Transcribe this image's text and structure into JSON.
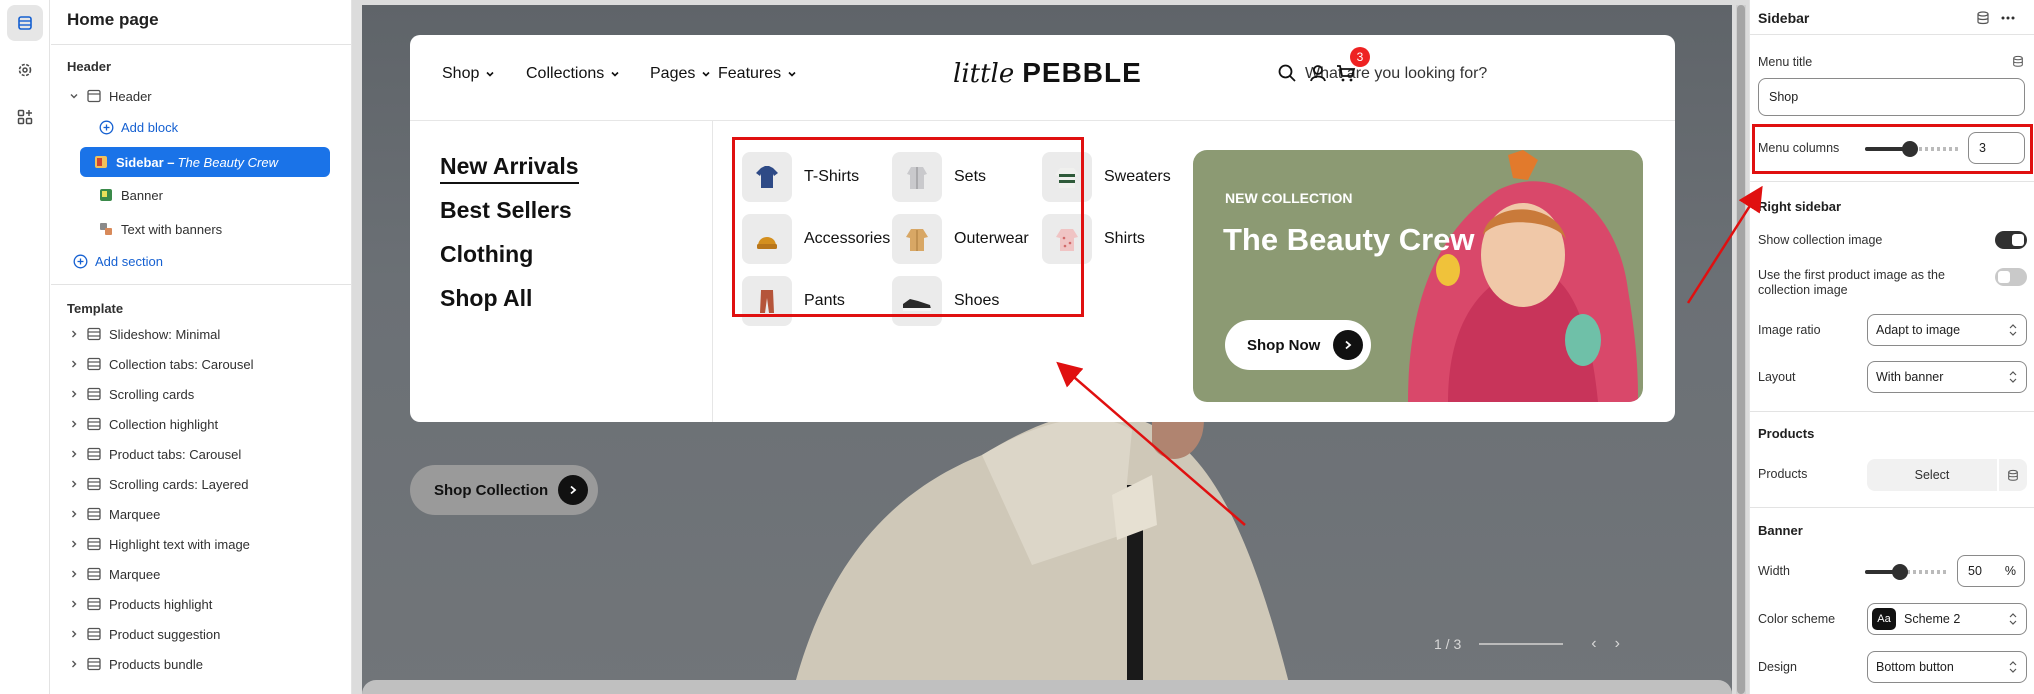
{
  "left_panel": {
    "title": "Home page",
    "header_label": "Header",
    "header_items": [
      {
        "label": "Header"
      },
      {
        "label": "Add block"
      },
      {
        "label": "Sidebar – ",
        "label_em": "The Beauty Crew"
      },
      {
        "label": "Banner"
      },
      {
        "label": "Text with banners"
      },
      {
        "label": "Add section"
      }
    ],
    "template_label": "Template",
    "template_items": [
      "Slideshow: Minimal",
      "Collection tabs: Carousel",
      "Scrolling cards",
      "Collection highlight",
      "Product tabs: Carousel",
      "Scrolling cards: Layered",
      "Marquee",
      "Highlight text with image",
      "Marquee",
      "Products highlight",
      "Product suggestion",
      "Products bundle"
    ]
  },
  "preview": {
    "nav": [
      "Shop",
      "Collections",
      "Pages",
      "Features"
    ],
    "logo_script": "little",
    "logo_bold": "PEBBLE",
    "search_placeholder": "What are you looking for?",
    "cart_count": "3",
    "side_links": [
      "New Arrivals",
      "Best Sellers",
      "Clothing",
      "Shop All"
    ],
    "categories": [
      "T-Shirts",
      "Sets",
      "Sweaters",
      "Accessories",
      "Outerwear",
      "Shirts",
      "Pants",
      "Shoes"
    ],
    "banner": {
      "eyebrow": "NEW COLLECTION",
      "title": "The Beauty Crew",
      "button": "Shop Now",
      "background": "#8c9a73"
    },
    "hero_button": "Shop Collection",
    "pager": "1 / 3",
    "highlight_color": "#e01010"
  },
  "right_panel": {
    "title": "Sidebar",
    "menu_title_label": "Menu title",
    "menu_title_value": "Shop",
    "menu_columns_label": "Menu columns",
    "menu_columns_value": "3",
    "right_sidebar_heading": "Right sidebar",
    "show_collection_image_label": "Show collection image",
    "show_collection_image_on": true,
    "use_first_product_label": "Use the first product image as the collection image",
    "use_first_product_on": false,
    "image_ratio_label": "Image ratio",
    "image_ratio_value": "Adapt to image",
    "layout_label": "Layout",
    "layout_value": "With banner",
    "products_heading": "Products",
    "products_label": "Products",
    "products_button": "Select",
    "banner_heading": "Banner",
    "width_label": "Width",
    "width_value": "50",
    "width_unit": "%",
    "color_scheme_label": "Color scheme",
    "color_scheme_value": "Scheme 2",
    "color_scheme_chip": "Aa",
    "design_label": "Design",
    "design_value": "Bottom button"
  }
}
